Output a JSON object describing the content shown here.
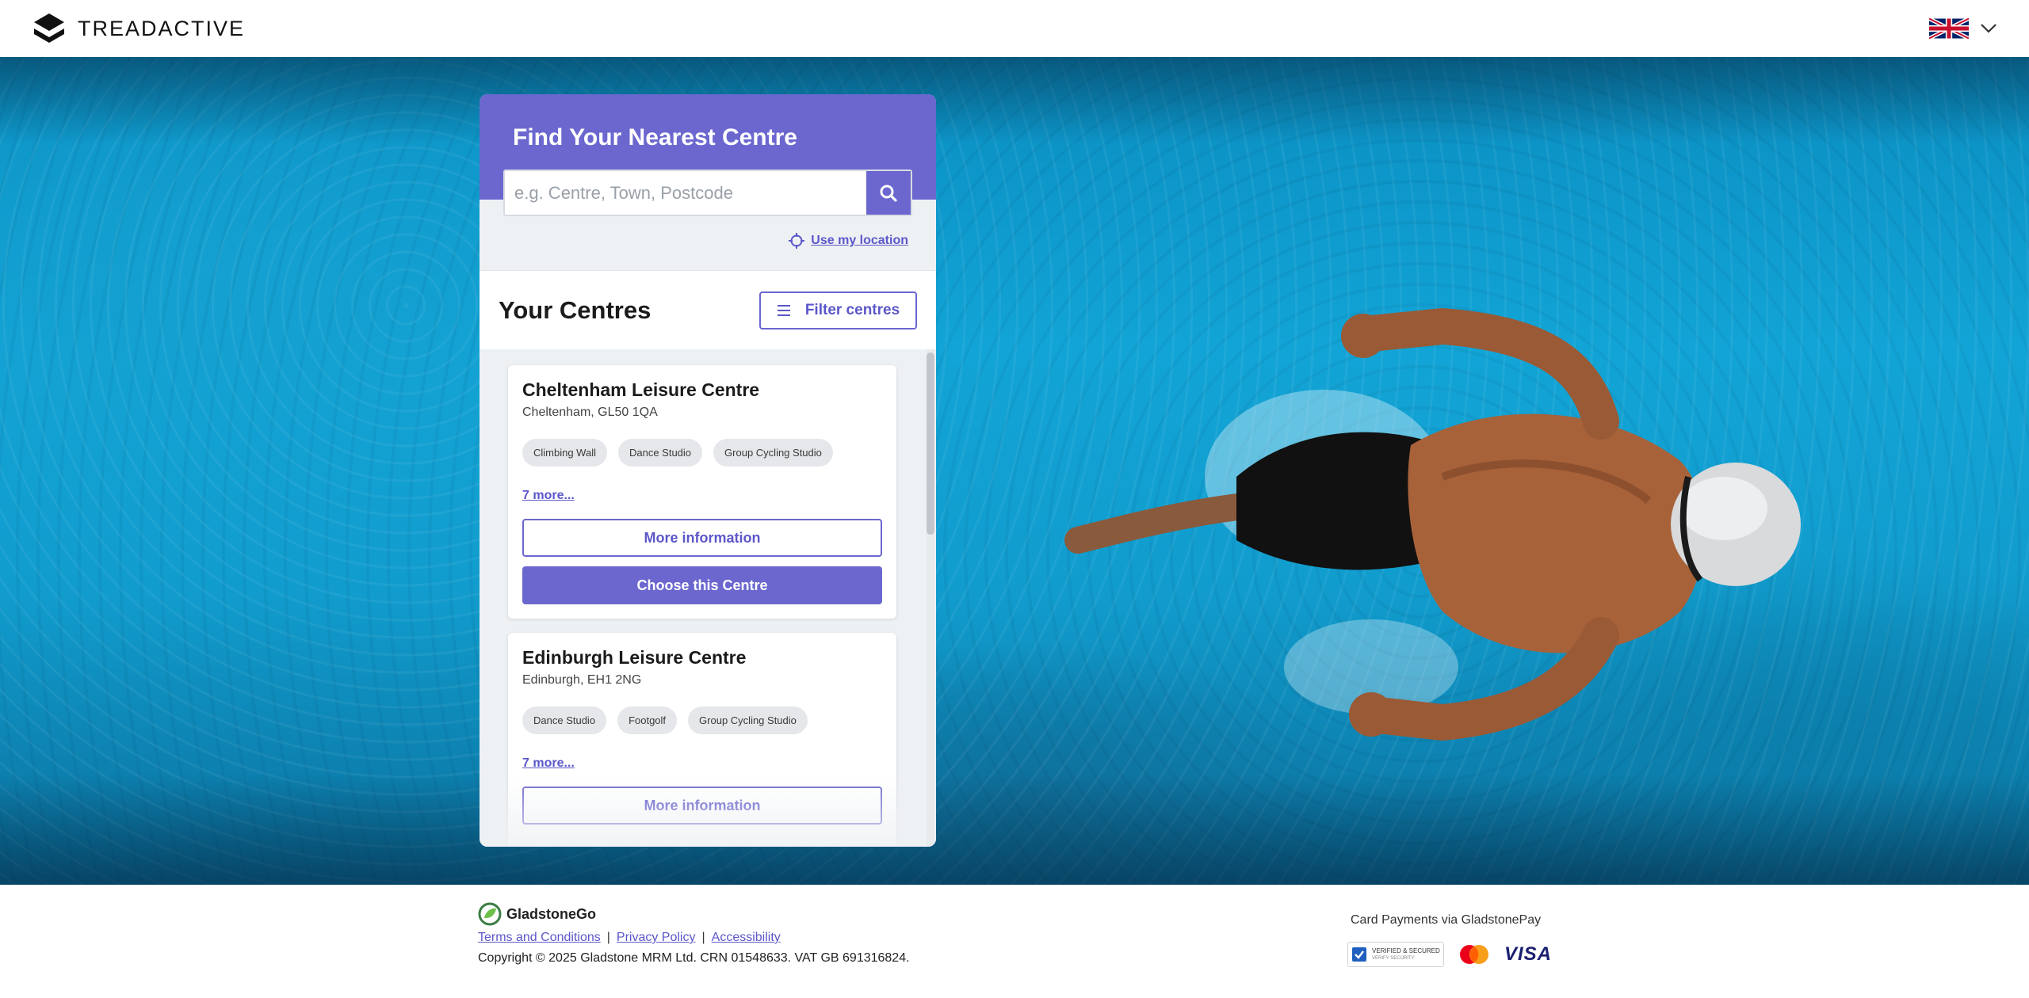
{
  "header": {
    "brand_name": "TREADACTIVE",
    "language_flag": "uk-flag-icon"
  },
  "finder": {
    "title": "Find Your Nearest Centre",
    "search_placeholder": "e.g. Centre, Town, Postcode",
    "search_value": "",
    "use_location_label": "Use my location"
  },
  "centres": {
    "title": "Your Centres",
    "filter_label": "Filter centres",
    "items": [
      {
        "name": "Cheltenham Leisure Centre",
        "address": "Cheltenham, GL50 1QA",
        "tags": [
          "Climbing Wall",
          "Dance Studio",
          "Group Cycling Studio"
        ],
        "more_label": "7 more...",
        "info_label": "More information",
        "choose_label": "Choose this Centre"
      },
      {
        "name": "Edinburgh Leisure Centre",
        "address": "Edinburgh, EH1 2NG",
        "tags": [
          "Dance Studio",
          "Footgolf",
          "Group Cycling Studio"
        ],
        "more_label": "7 more...",
        "info_label": "More information"
      }
    ]
  },
  "footer": {
    "provider": "GladstoneGo",
    "links": [
      "Terms and Conditions",
      "Privacy Policy",
      "Accessibility"
    ],
    "copyright": "Copyright © 2025 Gladstone MRM Ltd. CRN 01548633. VAT GB 691316824.",
    "payments_title": "Card Payments via GladstonePay",
    "verified_badge": "VERIFIED & SECURED",
    "verified_sub": "VERIFY SECURITY",
    "visa_label": "VISA"
  },
  "colors": {
    "accent": "#6b67cf",
    "panel_bg": "#eef1f4",
    "water": "#12a4d6"
  }
}
